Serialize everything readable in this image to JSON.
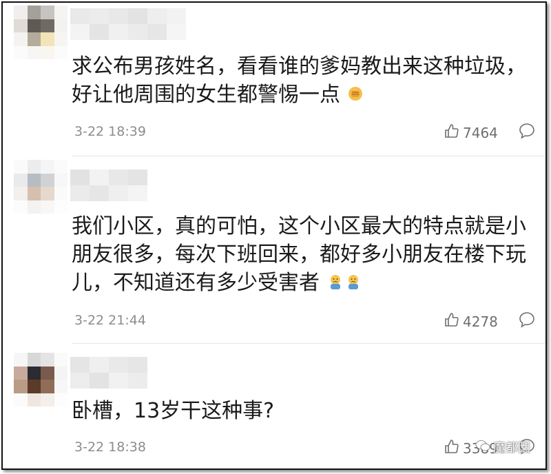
{
  "comments": [
    {
      "text": "求公布男孩姓名，看看谁的爹妈教出来这种垃圾，好让他周围的女生都警惕一点",
      "emoji": "fist-emoji",
      "time": "3-22 18:39",
      "likes": "7464"
    },
    {
      "text": "我们小区，真的可怕，这个小区最大的特点就是小朋友很多，每次下班回来，都好多小朋友在楼下玩儿，不知道还有多少受害者",
      "emoji": "sad-emoji",
      "time": "3-22 21:44",
      "likes": "4278"
    },
    {
      "text": "卧槽，13岁干这种事?",
      "time": "3-22 18:38",
      "likes": "3389"
    }
  ],
  "icons": {
    "like": "thumbs-up-icon",
    "reply": "comment-bubble-icon"
  },
  "watermark": {
    "text": "魔都囡"
  }
}
